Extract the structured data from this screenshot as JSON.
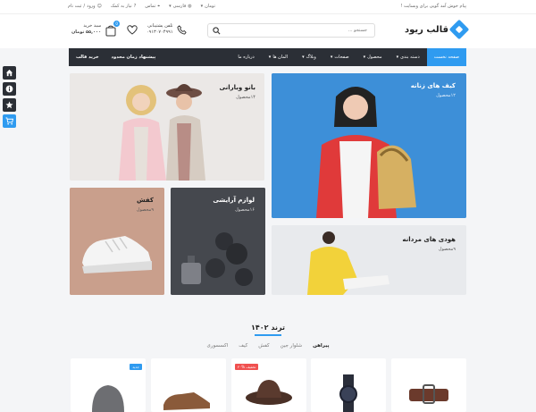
{
  "topbar": {
    "welcome": "پیام خوش آمد گویی برای وبسایت !",
    "currency": "تومان",
    "language": "فارسی",
    "contact": "تماس",
    "wishlist": "نیاز به کمک",
    "login": "ورود",
    "register": "ثبت نام"
  },
  "header": {
    "logo_text": "قالب ریود",
    "search_placeholder": "جستجو ...",
    "support_label": "تلفن پشتیبانی",
    "support_phone": "۰۹۱۳۰۷۰۴۹۹۱",
    "cart_label": "سبد خرید",
    "cart_total": "۵۵,۰۰۰ تومان",
    "cart_count": "0"
  },
  "nav": {
    "items": [
      {
        "label": "صفحه نخست",
        "active": true,
        "dropdown": false
      },
      {
        "label": "دسته بندی",
        "active": false,
        "dropdown": true
      },
      {
        "label": "محصول",
        "active": false,
        "dropdown": true
      },
      {
        "label": "صفحات",
        "active": false,
        "dropdown": true
      },
      {
        "label": "وبلاگ",
        "active": false,
        "dropdown": true
      },
      {
        "label": "المان ها",
        "active": false,
        "dropdown": true
      },
      {
        "label": "درباره ما",
        "active": false,
        "dropdown": false
      }
    ],
    "limited_offer": "پیشنهاد زمان محدود",
    "buy_theme": "خرید قالب"
  },
  "banners": {
    "women": {
      "title": "بانو وبارانی",
      "sub": "۱۴محصول"
    },
    "bag": {
      "title": "کیف های زنانه",
      "sub": "۱۲محصول"
    },
    "shoes": {
      "title": "کفش",
      "sub": "۹محصول"
    },
    "cosmetics": {
      "title": "لوازم آرایشی",
      "sub": "۱۶محصول"
    },
    "hoodie": {
      "title": "هودی های مردانه",
      "sub": "۹محصول"
    }
  },
  "trend": {
    "title": "ترند ۱۴۰۲",
    "tabs": [
      {
        "label": "پیراهن",
        "active": true
      },
      {
        "label": "شلوار جین",
        "active": false
      },
      {
        "label": "کفش",
        "active": false
      },
      {
        "label": "کیف",
        "active": false
      },
      {
        "label": "اکسسوری",
        "active": false
      }
    ],
    "cards": [
      {
        "tag": "",
        "tag_color": "",
        "kind": "belt"
      },
      {
        "tag": "",
        "tag_color": "",
        "kind": "watch"
      },
      {
        "tag": "۴۰% تخفیف",
        "tag_color": "#f0504f",
        "kind": "hat"
      },
      {
        "tag": "",
        "tag_color": "",
        "kind": "shoe"
      },
      {
        "tag": "جدید",
        "tag_color": "#2f9bf0",
        "kind": "beanie"
      }
    ]
  },
  "colors": {
    "accent": "#2f9bf0",
    "nav_bg": "#2b2f36",
    "sale": "#f0504f"
  }
}
